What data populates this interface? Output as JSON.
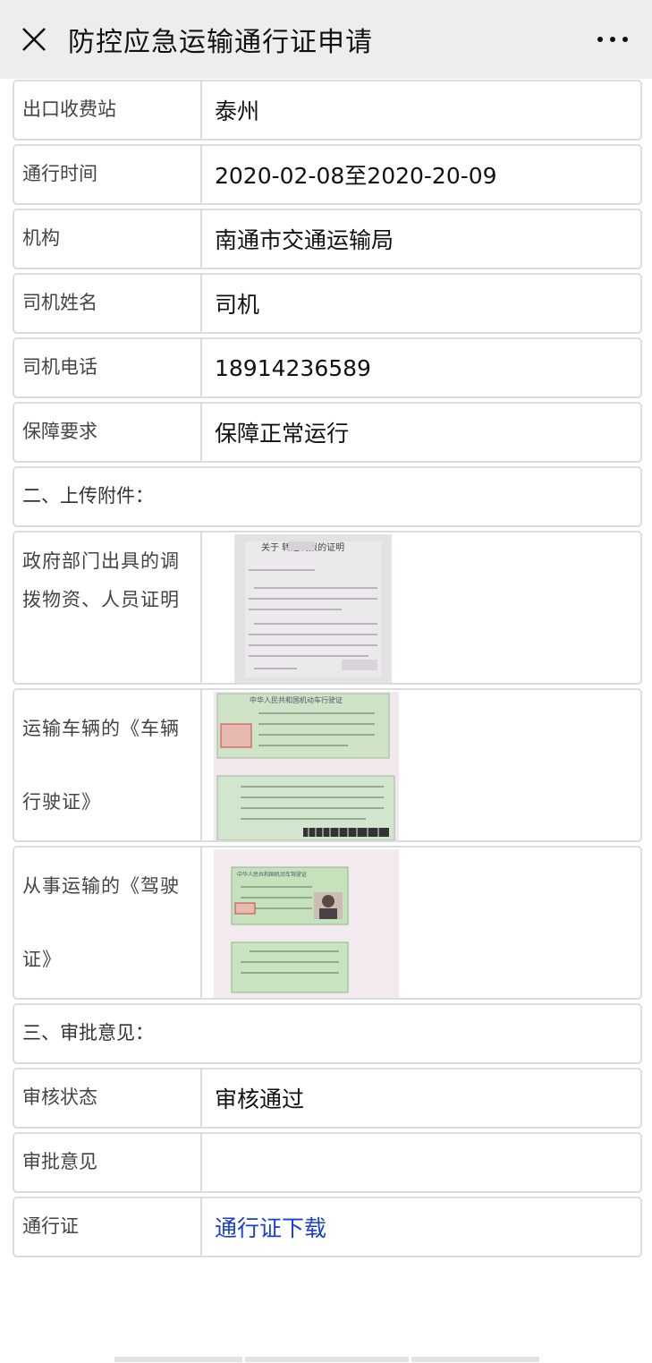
{
  "header": {
    "title": "防控应急运输通行证申请",
    "close_icon": "close-icon",
    "more_icon": "more-dots-icon"
  },
  "fields": [
    {
      "label": "出口收费站",
      "value": "泰州"
    },
    {
      "label": "通行时间",
      "value": "2020-02-08至2020-20-09"
    },
    {
      "label": "机构",
      "value": "南通市交通运输局"
    },
    {
      "label": "司机姓名",
      "value": "司机"
    },
    {
      "label": "司机电话",
      "value": "18914236589"
    },
    {
      "label": "保障要求",
      "value": "保障正常运行"
    }
  ],
  "attachments": {
    "section_title": "二、上传附件：",
    "items": [
      {
        "label": "政府部门出具的调拨物资、人员证明",
        "image": "government-certificate-photo",
        "image_text": "关于 转运调拨的证明"
      },
      {
        "label": "运输车辆的《车辆行驶证》",
        "image": "vehicle-license-photo",
        "image_text": "中华人民共和国机动车行驶证"
      },
      {
        "label": "从事运输的《驾驶证》",
        "image": "driver-license-photo",
        "image_text": "中华人民共和国机动车驾驶证"
      }
    ]
  },
  "approval": {
    "section_title": "三、审批意见：",
    "status_label": "审核状态",
    "status_value": "审核通过",
    "comment_label": "审批意见",
    "comment_value": "",
    "pass_label": "通行证",
    "pass_link": "通行证下载"
  }
}
